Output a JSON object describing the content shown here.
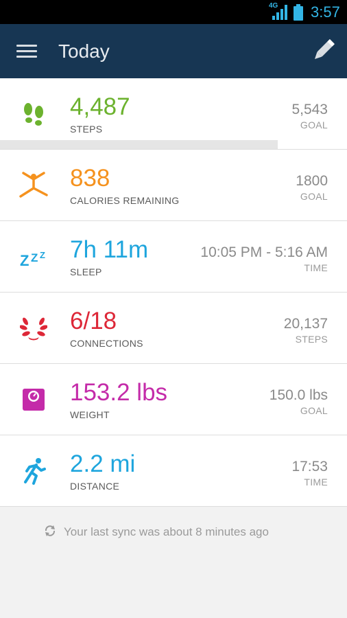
{
  "status_bar": {
    "network": "4G",
    "time": "3:57",
    "icons": [
      "signal-icon",
      "battery-icon"
    ]
  },
  "app_bar": {
    "title": "Today",
    "icons": [
      "menu-icon",
      "pencil-icon"
    ]
  },
  "rows": [
    {
      "id": "steps",
      "value": "4,487",
      "label": "STEPS",
      "right_value": "5,543",
      "right_label": "GOAL",
      "color": "#6cb22e",
      "icon": "footprints-icon",
      "progress": 0.8
    },
    {
      "id": "calories",
      "value": "838",
      "label": "CALORIES REMAINING",
      "right_value": "1800",
      "right_label": "GOAL",
      "color": "#f5921e",
      "icon": "jumping-person-icon"
    },
    {
      "id": "sleep",
      "value": "7h 11m",
      "label": "SLEEP",
      "right_value": "10:05 PM - 5:16 AM",
      "right_label": "TIME",
      "color": "#1ea5dd",
      "icon": "zzz-icon"
    },
    {
      "id": "connections",
      "value": "6/18",
      "label": "CONNECTIONS",
      "right_value": "20,137",
      "right_label": "STEPS",
      "color": "#dd2737",
      "icon": "laurel-wreath-icon"
    },
    {
      "id": "weight",
      "value": "153.2 lbs",
      "label": "WEIGHT",
      "right_value": "150.0 lbs",
      "right_label": "GOAL",
      "color": "#c42ba9",
      "icon": "scale-icon"
    },
    {
      "id": "distance",
      "value": "2.2 mi",
      "label": "DISTANCE",
      "right_value": "17:53",
      "right_label": "TIME",
      "color": "#1ea5dd",
      "icon": "runner-icon"
    }
  ],
  "sync": {
    "text": "Your last sync was about 8 minutes ago",
    "icon": "sync-icon"
  }
}
